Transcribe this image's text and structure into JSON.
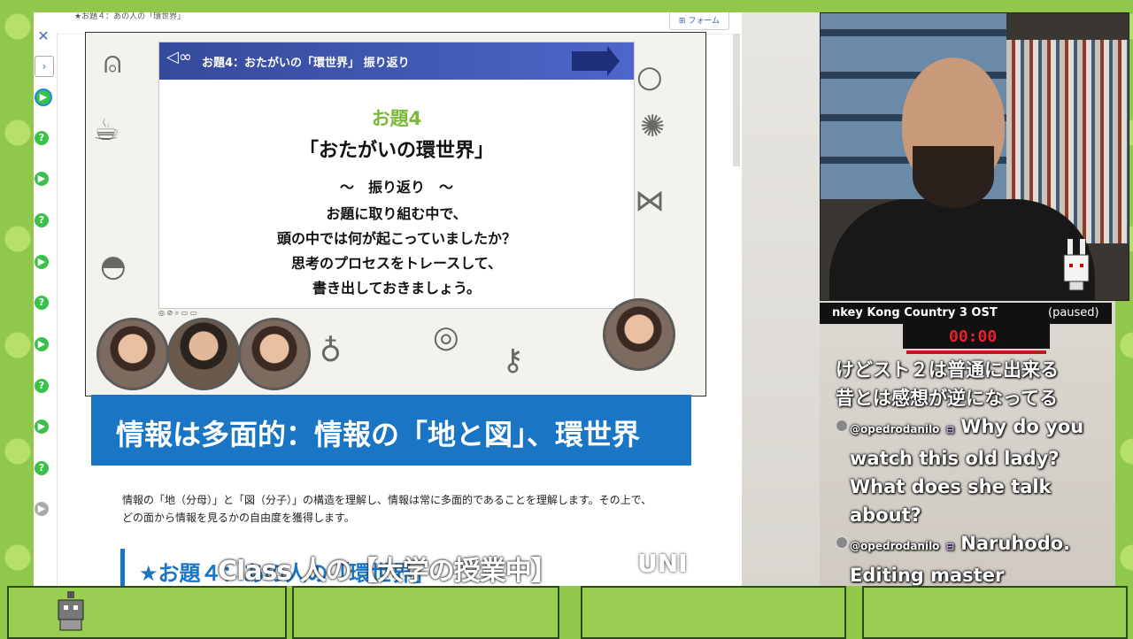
{
  "document": {
    "tab_title": "★お題４：あの人の「環世界」",
    "form_button": "フォーム",
    "nav_close": "✕",
    "nav_next": "›",
    "slide": {
      "header": "お題4：おたがいの「環世界」 振り返り",
      "number": "お題4",
      "title": "「おたがいの環世界」",
      "subtitle": "～　振り返り　～",
      "body_lines": [
        "お題に取り組む中で、",
        "頭の中では何が起こっていましたか？",
        "思考のプロセスをトレースして、",
        "書き出しておきましょう。"
      ],
      "toolbar": "◎ ⊘ ⌕ ▭ ▭"
    },
    "banner": "情報は多面的：情報の「地と図」、環世界",
    "paragraph": "情報の「地（分母）」と「図（分子）」の構造を理解し、情報は常に多面的であることを理解します。その上で、どの面から情報を見るかの自由度を獲得します。",
    "section_heading": "★お題４：あの人の「環世界」"
  },
  "captions": {
    "main": "Class 人の【大学の授業中】",
    "side": "UNI"
  },
  "stream": {
    "now_playing": "nkey Kong Country 3 OST",
    "status": "(paused)",
    "timer": "00:00"
  },
  "chat": [
    {
      "text": "けどスト２は普通に出来る"
    },
    {
      "text": "昔とは感想が逆になってる"
    },
    {
      "user": "@opedrodanilo",
      "badge": "⊟",
      "lines": [
        "Why do you",
        "watch this old lady?",
        "What does she talk",
        "about?"
      ]
    },
    {
      "user": "@opedrodanilo",
      "badge": "⊟",
      "lines": [
        "Naruhodo.",
        "Editing master"
      ]
    }
  ],
  "rail_icons": [
    "play",
    "help",
    "play",
    "help",
    "help",
    "play",
    "help",
    "play",
    "help",
    "play",
    "help",
    "play-gray"
  ],
  "colors": {
    "accent": "#1a75c4",
    "slide_header": "#3f57b6",
    "green": "#38c24a",
    "timer_red": "#e8202a"
  }
}
